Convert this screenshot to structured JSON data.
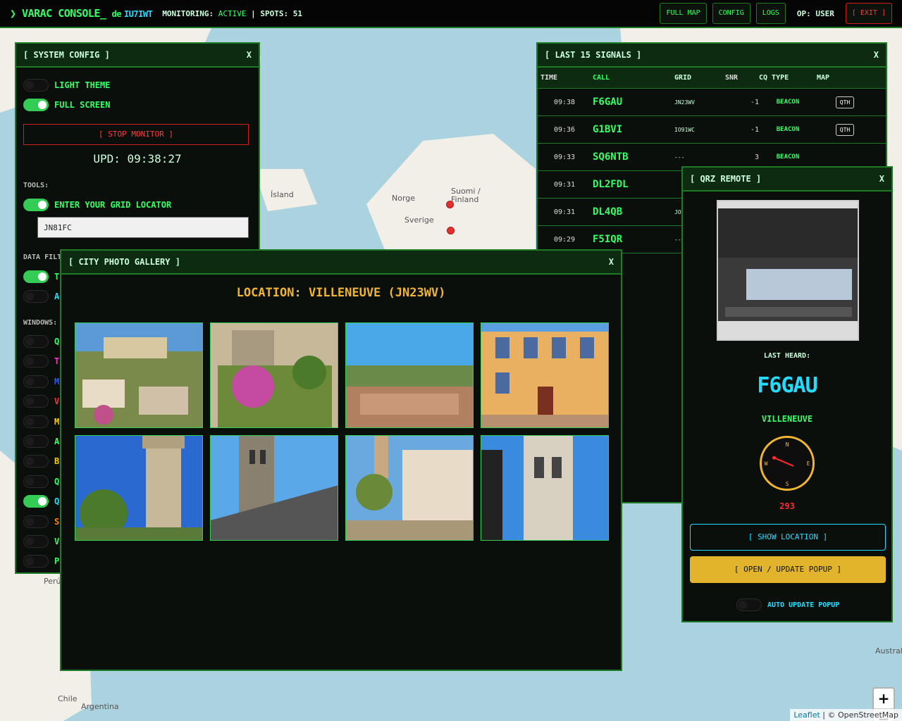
{
  "header": {
    "brand": "❯ VARAC CONSOLE_",
    "de": "de",
    "callsign": "IU7IWT",
    "monitoring_label": "MONITORING:",
    "monitoring_value": "ACTIVE",
    "spots_label": "| SPOTS: 51",
    "buttons": {
      "full_map": "FULL MAP",
      "config": "CONFIG",
      "logs": "LOGS",
      "exit": "[ EXIT ]"
    },
    "op_label": "OP: USER"
  },
  "map": {
    "labels": [
      "Ísland",
      "Norge",
      "Suomi / Finland",
      "Sverige",
      "Perú",
      "Chile",
      "Argentina",
      "Austral"
    ],
    "zoom_in": "+",
    "zoom_out": "−",
    "attribution_link": "Leaflet",
    "attribution_rest": " | © OpenStreetMap"
  },
  "config": {
    "title": "[ SYSTEM CONFIG ]",
    "close": "X",
    "light_theme": "LIGHT THEME",
    "full_screen": "FULL SCREEN",
    "stop_monitor": "[ STOP MONITOR ]",
    "upd": "UPD: 09:38:27",
    "tools_label": "TOOLS:",
    "enter_grid": "ENTER YOUR GRID LOCATOR",
    "grid_value": "JN81FC",
    "data_filters_label": "DATA FILT",
    "filter_rows": [
      "T",
      "A"
    ],
    "windows_label": "WINDOWS:",
    "window_rows": [
      "Q",
      "T",
      "M",
      "V",
      "M",
      "A",
      "B",
      "Q",
      "Q",
      "S",
      "V",
      "PROPAGATION"
    ],
    "window_colors": [
      "#33ff66",
      "#ff33cc",
      "#3355ff",
      "#ff3333",
      "#ffcc00",
      "#33ff66",
      "#ffcc00",
      "#33ff66",
      "#22ddff",
      "#ff8800",
      "#33ff66",
      "#33ff66"
    ]
  },
  "signals": {
    "title": "[ LAST 15 SIGNALS ]",
    "close": "X",
    "columns": [
      "TIME",
      "CALL",
      "GRID",
      "SNR",
      "CQ TYPE",
      "MAP"
    ],
    "rows": [
      {
        "time": "09:38",
        "call": "F6GAU",
        "grid": "JN23WV",
        "snr": "-1",
        "type": "BEACON",
        "map": "QTH"
      },
      {
        "time": "09:36",
        "call": "G1BVI",
        "grid": "IO91WC",
        "snr": "-1",
        "type": "BEACON",
        "map": "QTH"
      },
      {
        "time": "09:33",
        "call": "SQ6NTB",
        "grid": "---",
        "snr": "3",
        "type": "BEACON",
        "map": ""
      },
      {
        "time": "09:31",
        "call": "DL2FDL",
        "grid": "",
        "snr": "",
        "type": "",
        "map": ""
      },
      {
        "time": "09:31",
        "call": "DL4QB",
        "grid": "JO",
        "snr": "",
        "type": "",
        "map": ""
      },
      {
        "time": "09:29",
        "call": "F5IQR",
        "grid": "--",
        "snr": "",
        "type": "",
        "map": ""
      }
    ]
  },
  "gallery": {
    "title": "[ CITY PHOTO GALLERY ]",
    "close": "X",
    "location": "LOCATION: VILLENEUVE (JN23WV)"
  },
  "qrz": {
    "title": "[ QRZ REMOTE ]",
    "close": "X",
    "last_heard": "LAST HEARD:",
    "call": "F6GAU",
    "city": "VILLENEUVE",
    "bearing": "293",
    "compass": {
      "n": "N",
      "e": "E",
      "s": "S",
      "w": "W"
    },
    "show_location": "[ SHOW LOCATION ]",
    "open_popup": "[ OPEN / UPDATE POPUP ]",
    "auto_update": "AUTO UPDATE POPUP"
  }
}
